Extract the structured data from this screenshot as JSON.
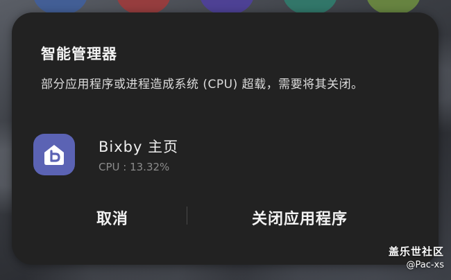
{
  "dialog": {
    "title": "智能管理器",
    "message": "部分应用程序或进程造成系统 (CPU) 超载，需要将其关闭。",
    "app": {
      "name": "Bixby 主页",
      "cpu": "CPU : 13.32%",
      "icon": "bixby-home-icon"
    },
    "buttons": {
      "cancel": "取消",
      "close_app": "关闭应用程序"
    }
  },
  "watermark": {
    "brand": "盖乐世社区",
    "user": "@Pac-xs"
  },
  "colors": {
    "dialog_bg": "#222222",
    "app_icon_bg": "#5b63b4"
  }
}
